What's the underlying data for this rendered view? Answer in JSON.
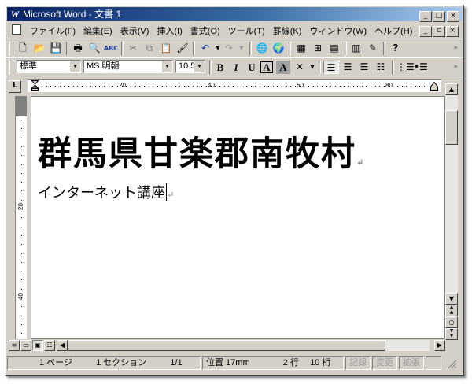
{
  "window": {
    "app_icon": "W",
    "title": "Microsoft Word - 文書 1",
    "caption_buttons": [
      "_",
      "□",
      "×"
    ],
    "mdi_buttons": [
      "_",
      "▫",
      "×"
    ]
  },
  "menu": {
    "items": [
      "ファイル(F)",
      "編集(E)",
      "表示(V)",
      "挿入(I)",
      "書式(O)",
      "ツール(T)",
      "罫線(K)",
      "ウィンドウ(W)",
      "ヘルプ(H)"
    ]
  },
  "toolbar_standard": {
    "buttons": [
      {
        "name": "new-icon",
        "glyph": "🗋"
      },
      {
        "name": "open-icon",
        "glyph": "📂"
      },
      {
        "name": "save-icon",
        "glyph": "💾"
      },
      {
        "name": "print-icon",
        "glyph": "🖶"
      },
      {
        "name": "print-preview-icon",
        "glyph": "🔍"
      },
      {
        "name": "spelling-icon",
        "glyph": "ABC✓"
      },
      {
        "name": "cut-icon",
        "glyph": "✂"
      },
      {
        "name": "copy-icon",
        "glyph": "⧉"
      },
      {
        "name": "paste-icon",
        "glyph": "📋"
      },
      {
        "name": "format-painter-icon",
        "glyph": "🖌"
      },
      {
        "name": "undo-icon",
        "glyph": "↶"
      },
      {
        "name": "redo-icon",
        "glyph": "↷"
      },
      {
        "name": "hyperlink-icon",
        "glyph": "🌐"
      },
      {
        "name": "web-toolbar-icon",
        "glyph": "🌍"
      },
      {
        "name": "tables-borders-icon",
        "glyph": "▦"
      },
      {
        "name": "insert-table-icon",
        "glyph": "⊞"
      },
      {
        "name": "insert-excel-icon",
        "glyph": "▤"
      },
      {
        "name": "columns-icon",
        "glyph": "▥"
      },
      {
        "name": "drawing-icon",
        "glyph": "✎"
      },
      {
        "name": "help-icon",
        "glyph": "?"
      }
    ]
  },
  "toolbar_format": {
    "style_value": "標準",
    "font_value": "MS 明朝",
    "size_value": "10.5",
    "bold": "B",
    "italic": "I",
    "underline": "U",
    "char_border": "A",
    "char_shading": "A",
    "align_icons": [
      "align-left-icon",
      "align-center-icon",
      "align-right-icon",
      "justify-icon"
    ],
    "list_icons": [
      "numbering-icon",
      "bullets-icon"
    ]
  },
  "ruler": {
    "tab_selector": "L",
    "labels": [
      "20",
      "40",
      "60",
      "80"
    ],
    "v_labels": [
      "20",
      "40"
    ]
  },
  "document": {
    "title_text": "群馬県甘楽郡南牧村",
    "subtitle_text": "インターネット講座",
    "paragraph_mark": "↵"
  },
  "status": {
    "page": "1 ページ",
    "section": "1 セクション",
    "pages": "1/1",
    "position": "位置 17mm",
    "line": "2 行",
    "column": "10 桁",
    "rec": "記録",
    "trk": "変更",
    "ext": "拡張"
  }
}
